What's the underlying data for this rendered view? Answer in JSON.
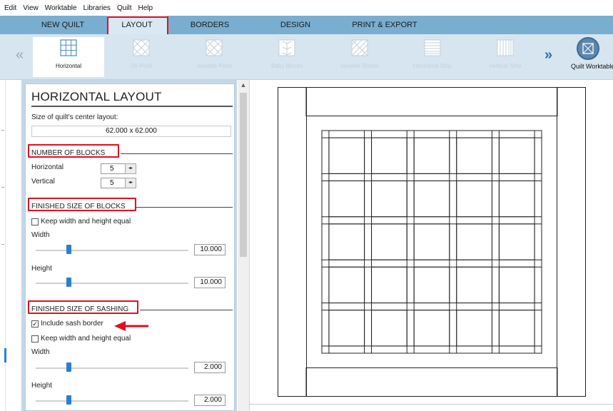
{
  "menu": [
    "Edit",
    "View",
    "Worktable",
    "Libraries",
    "Quilt",
    "Help"
  ],
  "tabs": [
    {
      "label": "NEW QUILT",
      "active": false
    },
    {
      "label": "LAYOUT",
      "active": true
    },
    {
      "label": "BORDERS",
      "active": false
    },
    {
      "label": "DESIGN",
      "active": false
    },
    {
      "label": "PRINT & EXPORT",
      "active": false
    }
  ],
  "ribbon": {
    "prev": "«",
    "next": "»",
    "items": [
      {
        "label": "Horizontal",
        "icon": "grid-layout-icon",
        "selected": true
      },
      {
        "label": "On-Point",
        "icon": "on-point-layout-icon",
        "selected": false
      },
      {
        "label": "Variable Point",
        "icon": "variable-point-layout-icon",
        "selected": false
      },
      {
        "label": "Baby Blocks",
        "icon": "baby-blocks-layout-icon",
        "selected": false
      },
      {
        "label": "Variable Blocks",
        "icon": "variable-blocks-layout-icon",
        "selected": false
      },
      {
        "label": "Horizontal Strip",
        "icon": "horizontal-strip-icon",
        "selected": false
      },
      {
        "label": "Vertical Strip",
        "icon": "vertical-strip-icon",
        "selected": false
      }
    ],
    "quilt_worktable": "Quilt Worktable"
  },
  "panel": {
    "title": "HORIZONTAL LAYOUT",
    "size_label": "Size of quilt's center layout:",
    "size_value": "62.000 x 62.000",
    "number_of_blocks": {
      "heading": "NUMBER OF BLOCKS",
      "horizontal_label": "Horizontal",
      "horizontal_value": "5",
      "vertical_label": "Vertical",
      "vertical_value": "5"
    },
    "finished_size_blocks": {
      "heading": "FINISHED SIZE OF BLOCKS",
      "keep_equal_label": "Keep width and height equal",
      "keep_equal_checked": false,
      "width_label": "Width",
      "width_value": "10.000",
      "width_slider": 0.2,
      "height_label": "Height",
      "height_value": "10.000",
      "height_slider": 0.2
    },
    "finished_size_sashing": {
      "heading": "FINISHED SIZE OF SASHING",
      "include_sash_border_label": "Include sash border",
      "include_sash_border_checked": true,
      "include_sash_border_mark": "✓",
      "keep_equal_label": "Keep width and height equal",
      "keep_equal_checked": false,
      "width_label": "Width",
      "width_value": "2.000",
      "width_slider": 0.2,
      "height_label": "Height",
      "height_value": "2.000",
      "height_slider": 0.2
    }
  },
  "quilt": {
    "blocks_horizontal": 5,
    "blocks_vertical": 5,
    "block_size": 10,
    "sash_size": 2,
    "sash_border": true
  },
  "colors": {
    "tab_bar": "#7aaed0",
    "ribbon": "#d6e5f0",
    "highlight_red": "#e01020",
    "slider_blue": "#2c7fd0"
  }
}
